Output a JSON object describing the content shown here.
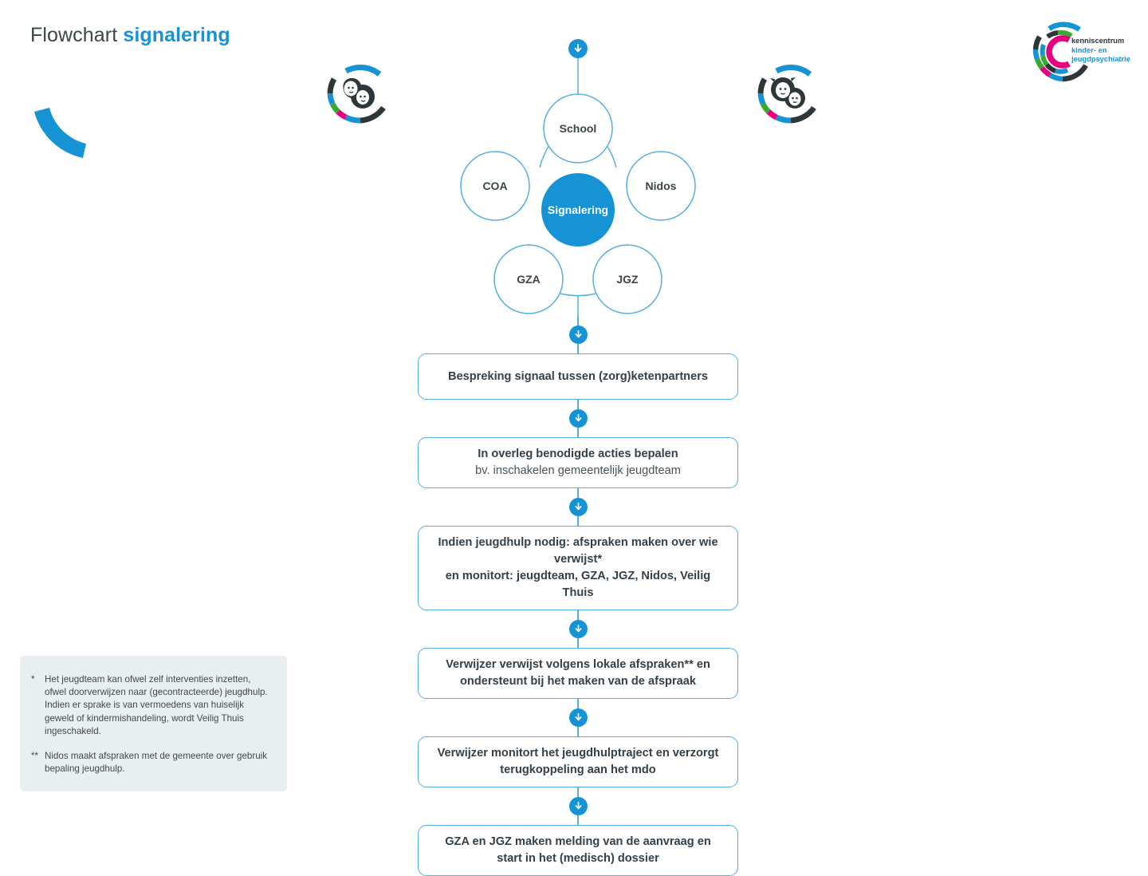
{
  "title": {
    "plain": "Flowchart ",
    "accent": "signalering"
  },
  "logo": {
    "line1": "kenniscentrum",
    "line2": "kinder- en",
    "line3": "jeugdpsychiatrie",
    "mark_name": "kenniscentrum-arc-logo"
  },
  "colors": {
    "accent_blue": "#1693d4",
    "light_blue": "#56aede",
    "dark_text": "#3b4548",
    "panel_bg": "#e9eef0",
    "logo_green": "#3aaa35",
    "logo_pink": "#e6007e",
    "logo_dark": "#2d3638",
    "logo_blue": "#1693d4"
  },
  "hub": {
    "center_label": "Signalering",
    "nodes": [
      {
        "label": "School"
      },
      {
        "label": "Nidos"
      },
      {
        "label": "JGZ"
      },
      {
        "label": "GZA"
      },
      {
        "label": "COA"
      }
    ]
  },
  "flow": {
    "entry_arrow": "down-arrow-icon",
    "steps": [
      {
        "lines": [
          {
            "text": "Bespreking signaal tussen (zorg)ketenpartners",
            "bold": true
          }
        ]
      },
      {
        "lines": [
          {
            "text": "In overleg benodigde acties bepalen",
            "bold": true
          },
          {
            "text": "bv. inschakelen gemeentelijk jeugdteam",
            "bold": false
          }
        ]
      },
      {
        "lines": [
          {
            "text": "Indien jeugdhulp nodig: afspraken maken over wie verwijst*",
            "bold": true
          },
          {
            "text": "en monitort: jeugdteam, GZA, JGZ, Nidos, Veilig Thuis",
            "bold": true
          }
        ]
      },
      {
        "lines": [
          {
            "text": "Verwijzer verwijst volgens lokale afspraken** en",
            "bold": true
          },
          {
            "text": "ondersteunt bij het maken van de afspraak",
            "bold": true
          }
        ]
      },
      {
        "lines": [
          {
            "text": "Verwijzer monitort het jeugdhulptraject en verzorgt",
            "bold": true
          },
          {
            "text": "terugkoppeling aan het mdo",
            "bold": true
          }
        ]
      },
      {
        "lines": [
          {
            "text": "GZA en JGZ maken melding van de aanvraag en",
            "bold": true
          },
          {
            "text": "start in het (medisch) dossier",
            "bold": true
          }
        ]
      }
    ]
  },
  "footnotes": [
    {
      "marker": "*",
      "text": "Het jeugdteam kan ofwel zelf interventies inzetten, ofwel doorverwijzen naar (gecontracteerde) jeugdhulp. Indien er sprake is van vermoedens van huiselijk geweld of kindermishandeling, wordt Veilig Thuis ingeschakeld."
    },
    {
      "marker": "**",
      "text": "Nidos maakt afspraken met de gemeente over gebruik bepaling jeugdhulp."
    }
  ]
}
